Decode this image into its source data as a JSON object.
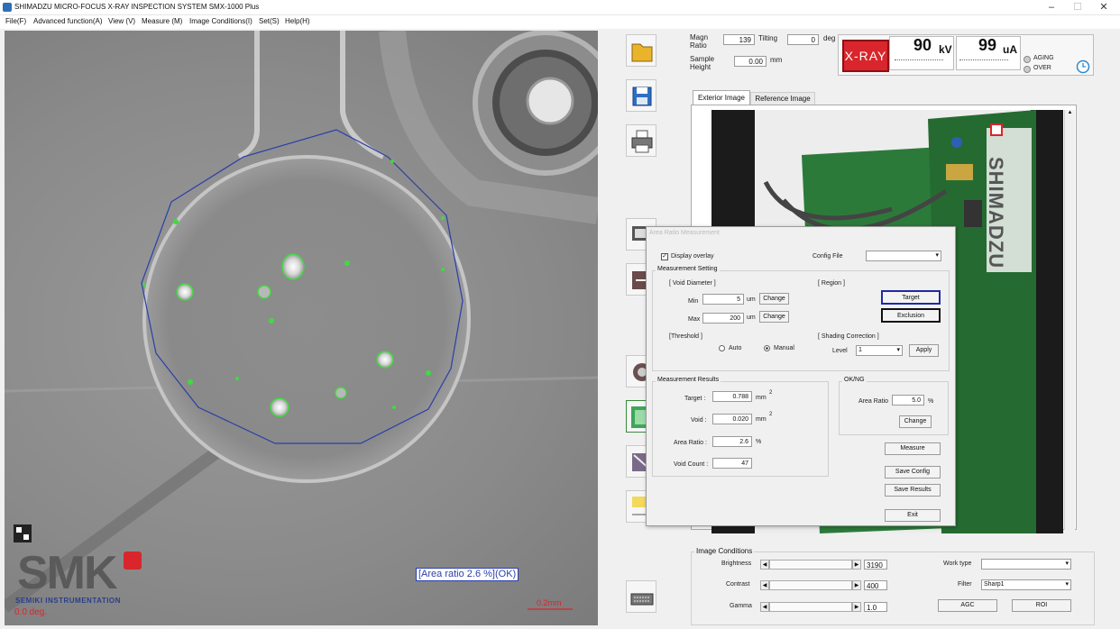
{
  "window": {
    "title": "SHIMADZU MICRO-FOCUS X-RAY INSPECTION SYSTEM SMX-1000 Plus"
  },
  "menu": [
    "File(F)",
    "Advanced function(A)",
    "View (V)",
    "Measure (M)",
    "Image Conditions(I)",
    "Set(S)",
    "Help(H)"
  ],
  "xray_view": {
    "area_overlay": "[Area ratio 2.6 %](OK)",
    "scale": "0.2mm",
    "angle": "0.0 deg.",
    "logo_text": "SMK",
    "logo_sub": "SEMIKI INSTRUMENTATION"
  },
  "status": {
    "magn_label": "Magn Ratio",
    "magn_value": "139",
    "tilting_label": "Tilting",
    "tilting_value": "0",
    "tilting_unit": "deg",
    "sample_height_label": "Sample Height",
    "sample_height_value": "0.00",
    "sample_height_unit": "mm"
  },
  "xray_control": {
    "button": "X-RAY",
    "kv_value": "90",
    "kv_unit": "kV",
    "ua_value": "99",
    "ua_unit": "uA",
    "aging": "AGING",
    "over": "OVER"
  },
  "tabs": [
    "Exterior Image",
    "Reference Image"
  ],
  "camera_image": {
    "brand": "SHIMADZU"
  },
  "dialog": {
    "title": "Area Ratio Measurement",
    "display_overlay": "Display overlay",
    "config_file_label": "Config File",
    "config_file_value": "",
    "measurement_setting": "Measurement Setting",
    "void_diameter": "[ Void Diameter ]",
    "min_label": "Min",
    "min_value": "5",
    "min_unit": "um",
    "max_label": "Max",
    "max_value": "200",
    "max_unit": "um",
    "change": "Change",
    "region": "[ Region ]",
    "target_btn": "Target",
    "exclusion_btn": "Exclusion",
    "threshold": "[Threshold ]",
    "auto": "Auto",
    "manual": "Manual",
    "shading_correction": "[ Shading Correction ]",
    "level_label": "Level",
    "level_value": "1",
    "apply": "Apply",
    "results_title": "Measurement Results",
    "target_label": "Target :",
    "target_value": "0.788",
    "target_unit": "mm",
    "void_label": "Void :",
    "void_value": "0.020",
    "void_unit": "mm",
    "sup2": "2",
    "area_ratio_label": "Area Ratio :",
    "area_ratio_value": "2.6",
    "area_ratio_unit": "%",
    "void_count_label": "Void Count :",
    "void_count_value": "47",
    "okng_title": "OK/NG",
    "okng_area_label": "Area Ratio",
    "okng_area_value": "5.0",
    "okng_area_unit": "%",
    "okng_change": "Change",
    "measure": "Measure",
    "save_config": "Save Config",
    "save_results": "Save Results",
    "exit": "Exit"
  },
  "image_conditions": {
    "title": "Image Conditions",
    "brightness_label": "Brightness",
    "brightness_value": "3190",
    "contrast_label": "Contrast",
    "contrast_value": "400",
    "gamma_label": "Gamma",
    "gamma_value": "1.0",
    "work_type_label": "Work type",
    "work_type_value": "",
    "filter_label": "Filter",
    "filter_value": "Sharp1",
    "agc": "AGC",
    "roi": "ROI"
  },
  "colors": {
    "xray_red": "#d8262c",
    "outline_blue": "#2b3fa8",
    "void_green": "#3ddc3d",
    "pcb_green": "#2c7a3a"
  }
}
